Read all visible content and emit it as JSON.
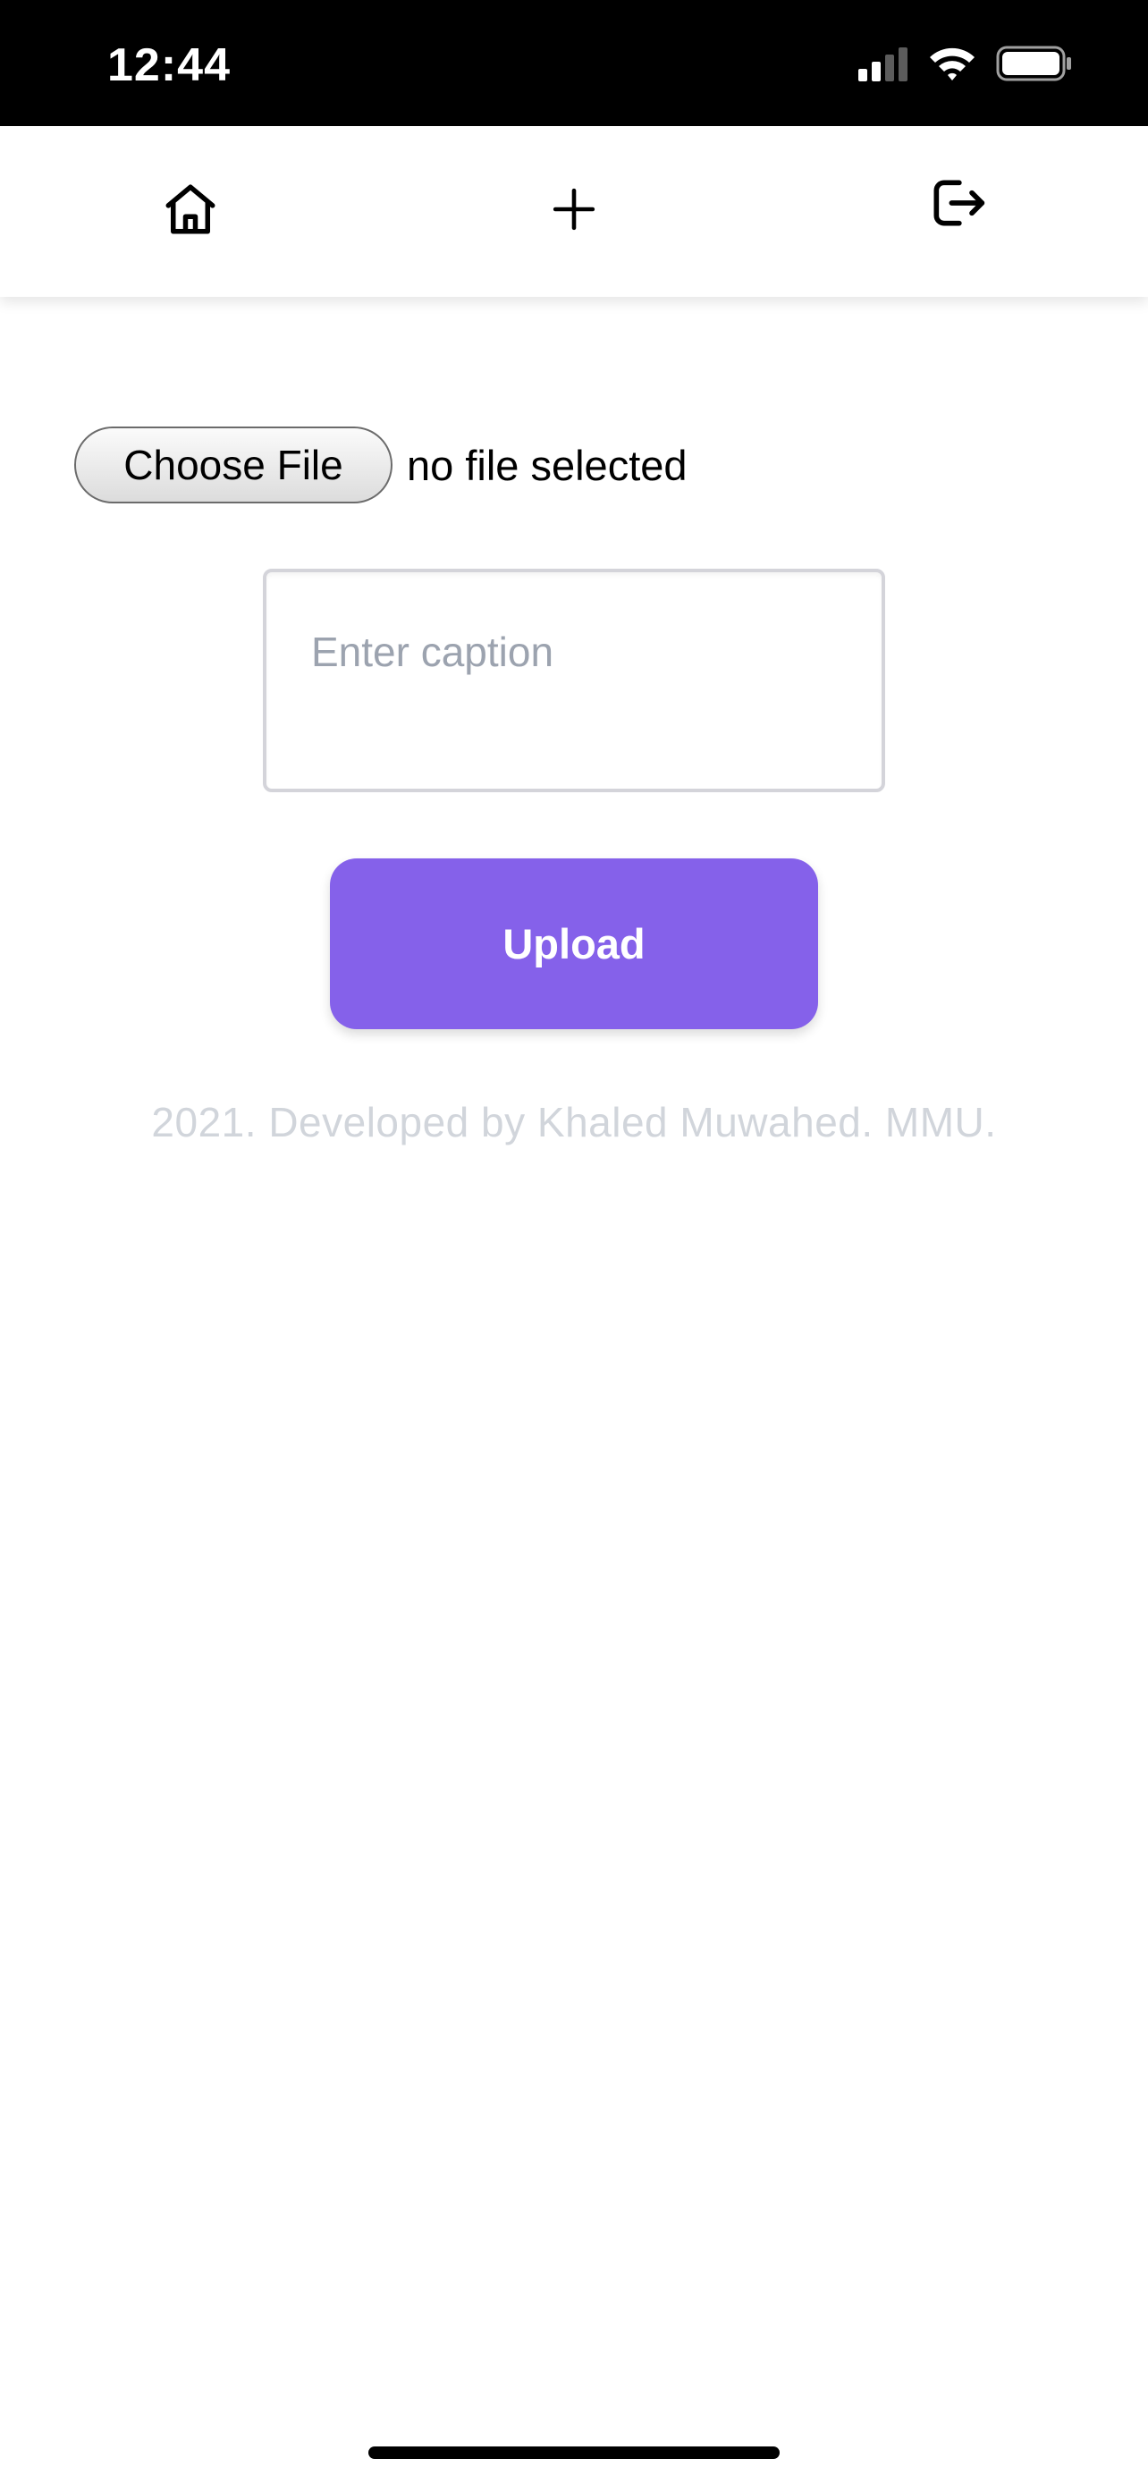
{
  "status_bar": {
    "time": "12:44",
    "icons": [
      "cellular-signal-icon",
      "wifi-icon",
      "battery-icon"
    ]
  },
  "nav": {
    "items": [
      {
        "icon": "home-icon"
      },
      {
        "icon": "plus-icon"
      },
      {
        "icon": "logout-icon"
      }
    ]
  },
  "upload_form": {
    "choose_file_label": "Choose File",
    "file_status": "no file selected",
    "caption_placeholder": "Enter caption",
    "caption_value": "",
    "upload_label": "Upload"
  },
  "footer": {
    "text": "2021. Developed by Khaled Muwahed. MMU."
  },
  "colors": {
    "accent": "#8561ea",
    "footer_text": "#d1d5db",
    "placeholder": "#9ca3af"
  }
}
